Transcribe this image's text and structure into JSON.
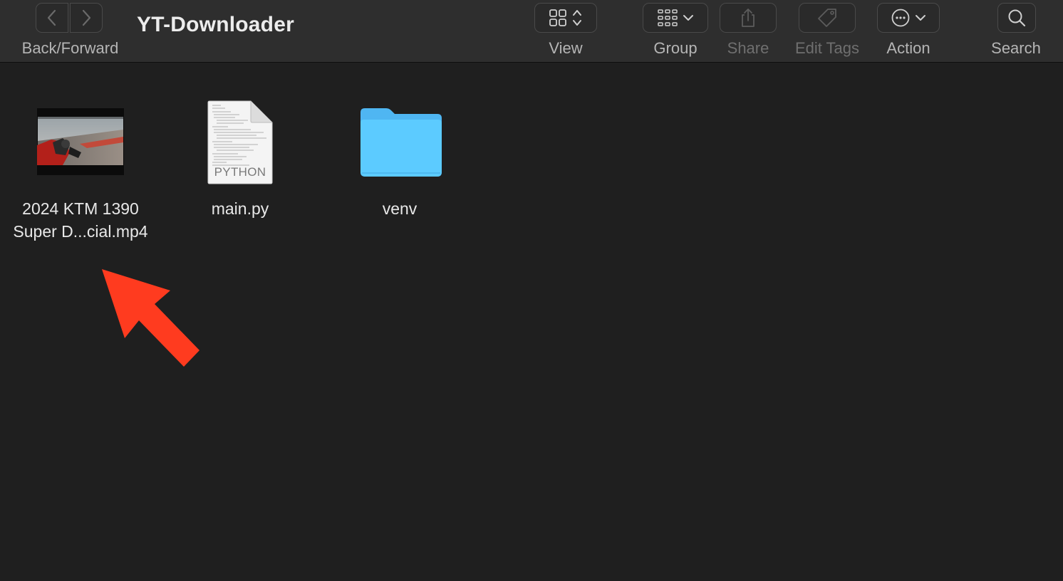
{
  "toolbar": {
    "title": "YT-Downloader",
    "back_forward_label": "Back/Forward",
    "view_label": "View",
    "group_label": "Group",
    "share_label": "Share",
    "edit_tags_label": "Edit Tags",
    "action_label": "Action",
    "search_label": "Search"
  },
  "files": [
    {
      "name_line1": "2024 KTM 1390",
      "name_line2": "Super D...cial.mp4",
      "kind": "video-thumbnail"
    },
    {
      "name_line1": "main.py",
      "badge": "PYTHON",
      "kind": "python-file-icon"
    },
    {
      "name_line1": "venv",
      "kind": "folder-icon"
    }
  ],
  "colors": {
    "toolbar_bg": "#2e2e2e",
    "content_bg": "#1f1f1f",
    "folder_blue": "#5ac8fa",
    "arrow_red": "#ff3b1f"
  },
  "annotation": {
    "kind": "arrow",
    "color": "#ff3b1f",
    "points_to": "2024 KTM 1390 Super D...cial.mp4"
  }
}
